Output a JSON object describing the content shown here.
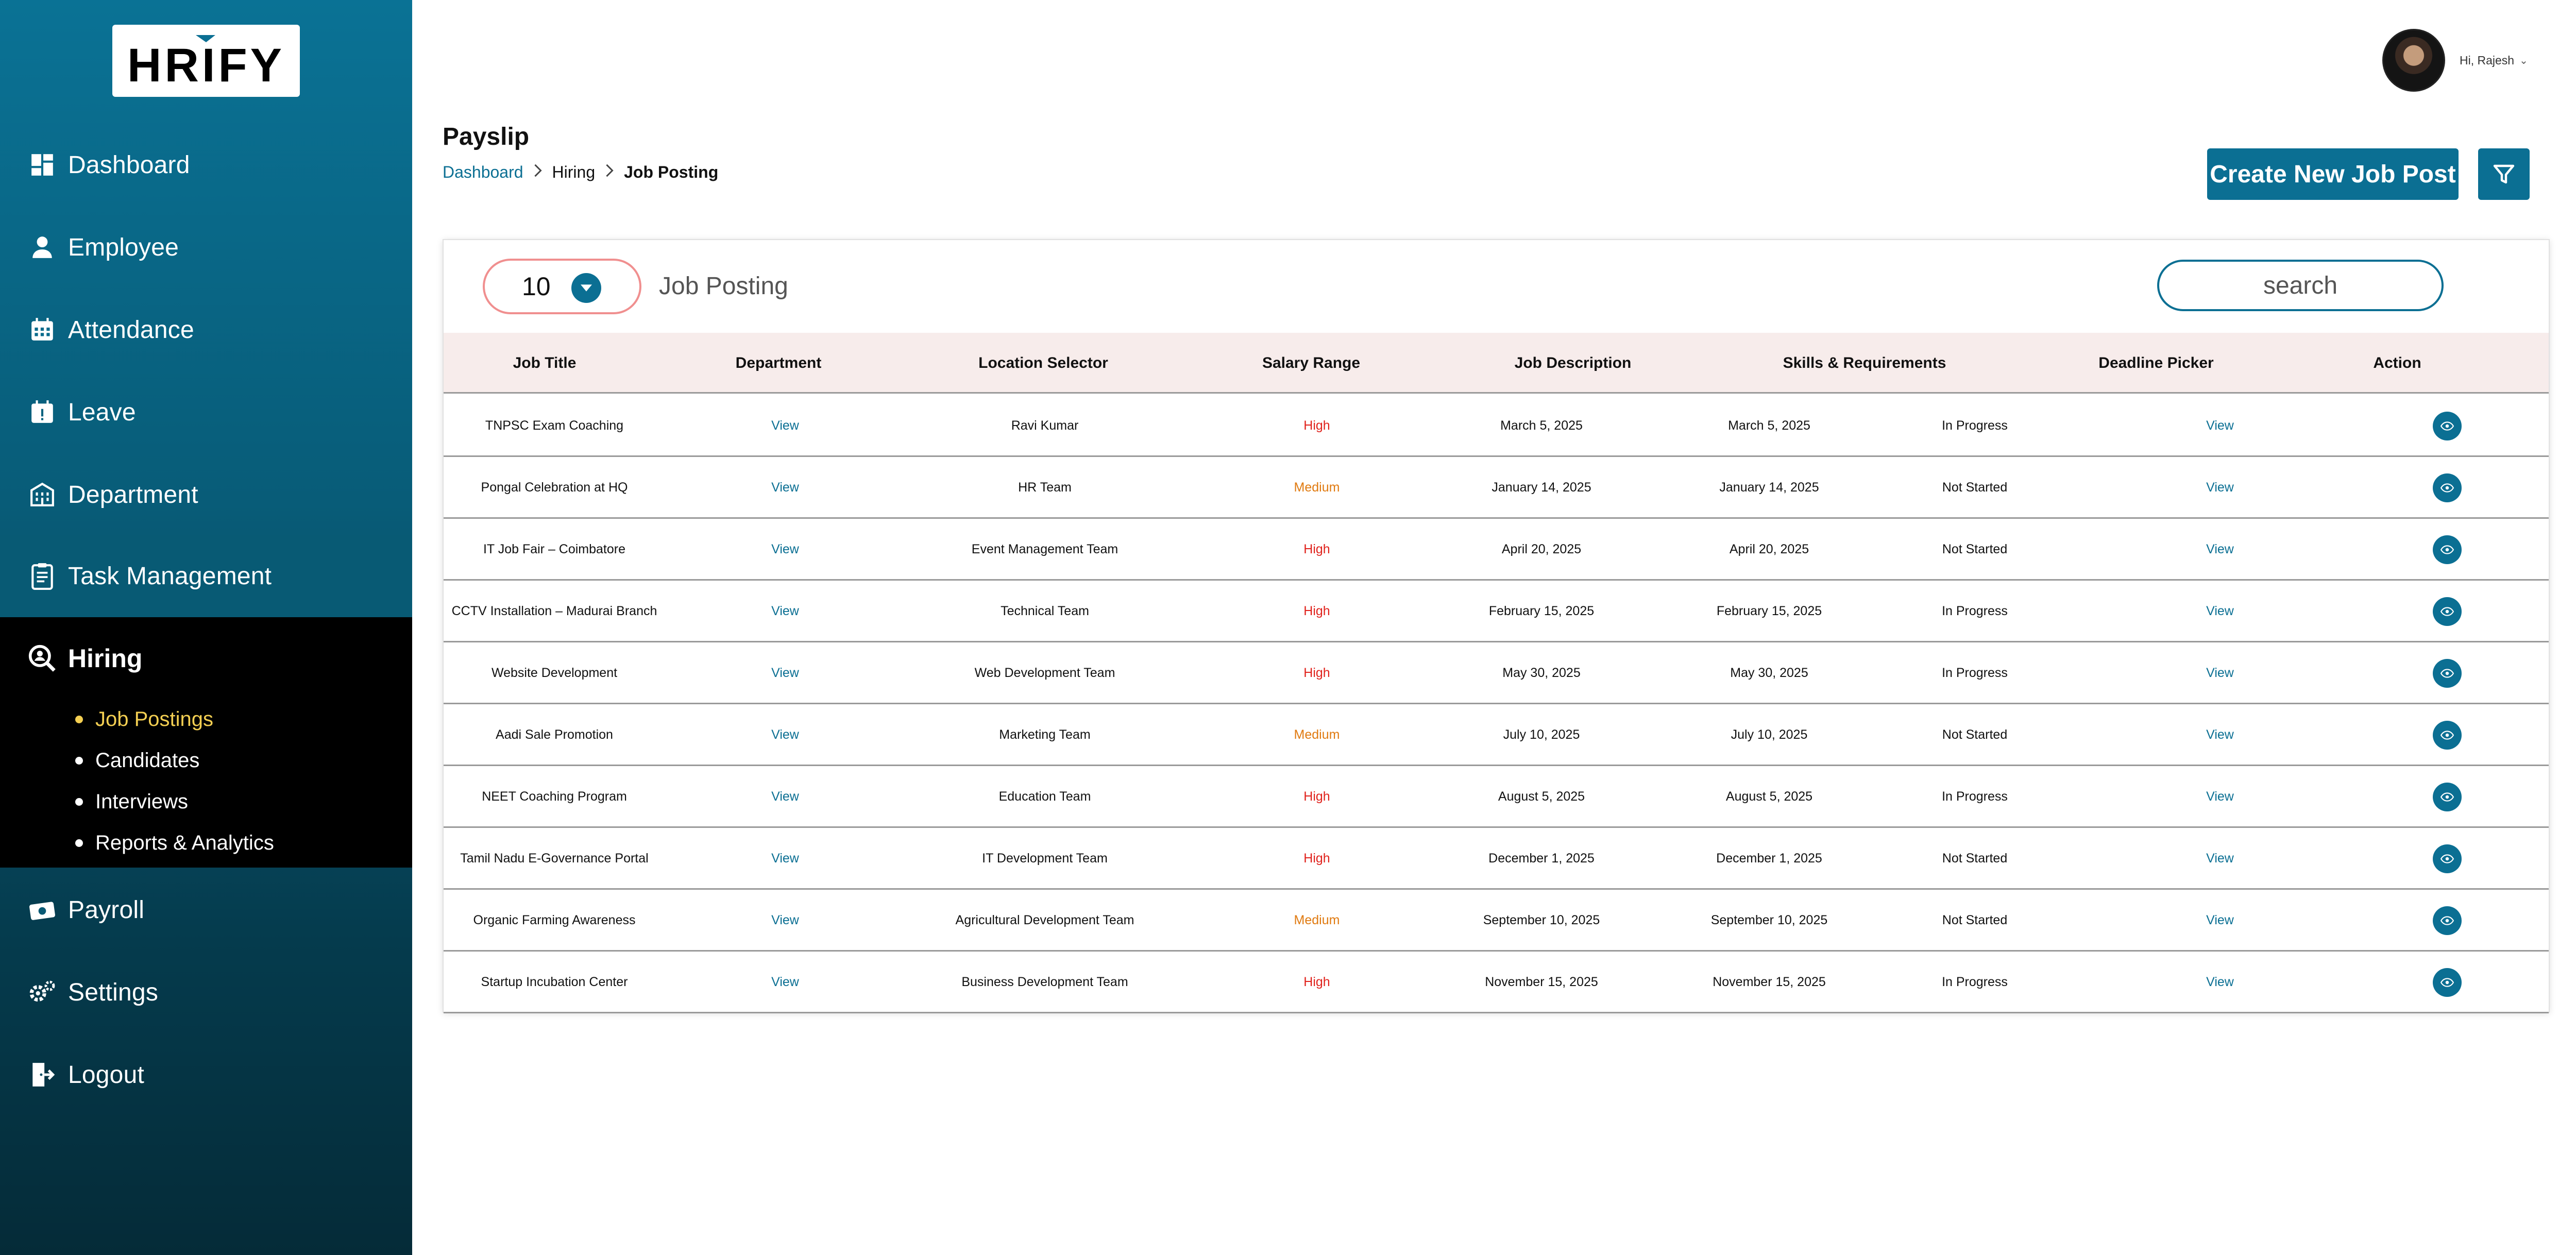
{
  "brand": {
    "logo_text": "HRIFY"
  },
  "sidebar": {
    "items": [
      {
        "label": "Dashboard",
        "icon": "dashboard-icon"
      },
      {
        "label": "Employee",
        "icon": "user-icon"
      },
      {
        "label": "Attendance",
        "icon": "calendar-icon"
      },
      {
        "label": "Leave",
        "icon": "calendar-alert-icon"
      },
      {
        "label": "Department",
        "icon": "building-icon"
      },
      {
        "label": "Task Management",
        "icon": "clipboard-icon"
      },
      {
        "label": "Hiring",
        "icon": "hiring-search-icon"
      },
      {
        "label": "Payroll",
        "icon": "money-icon"
      },
      {
        "label": "Settings",
        "icon": "gears-icon"
      },
      {
        "label": "Logout",
        "icon": "logout-icon"
      }
    ],
    "hiring_sub": [
      {
        "label": "Job Postings",
        "active": true
      },
      {
        "label": "Candidates",
        "active": false
      },
      {
        "label": "Interviews",
        "active": false
      },
      {
        "label": "Reports & Analytics",
        "active": false
      }
    ]
  },
  "header": {
    "greeting": "Hi, Rajesh",
    "chevron": "⌄",
    "title": "Payslip",
    "breadcrumb": [
      "Dashboard",
      "Hiring",
      "Job Posting"
    ],
    "create_button": "Create New Job Post",
    "filter_icon": "filter-icon"
  },
  "card": {
    "per_page": "10",
    "label": "Job Posting",
    "search_placeholder": "search"
  },
  "table": {
    "columns": [
      "Job Title",
      "Department",
      "Location Selector",
      "Salary Range",
      "Job Description",
      "Skills & Requirements",
      "Deadline Picker",
      "Action"
    ],
    "rows": [
      [
        "TNPSC Exam Coaching",
        "View",
        "Ravi Kumar",
        "High",
        "March 5, 2025",
        "March 5, 2025",
        "In Progress",
        "View"
      ],
      [
        "Pongal Celebration at HQ",
        "View",
        "HR Team",
        "Medium",
        "January 14, 2025",
        "January 14, 2025",
        "Not Started",
        "View"
      ],
      [
        "IT Job Fair – Coimbatore",
        "View",
        "Event Management Team",
        "High",
        "April 20, 2025",
        "April 20, 2025",
        "Not Started",
        "View"
      ],
      [
        "CCTV Installation – Madurai Branch",
        "View",
        "Technical Team",
        "High",
        "February 15, 2025",
        "February 15, 2025",
        "In Progress",
        "View"
      ],
      [
        "Website Development",
        "View",
        "Web Development Team",
        "High",
        "May 30, 2025",
        "May 30, 2025",
        "In Progress",
        "View"
      ],
      [
        "Aadi Sale Promotion",
        "View",
        "Marketing Team",
        "Medium",
        "July 10, 2025",
        "July 10, 2025",
        "Not Started",
        "View"
      ],
      [
        "NEET Coaching Program",
        "View",
        "Education Team",
        "High",
        "August 5, 2025",
        "August 5, 2025",
        "In Progress",
        "View"
      ],
      [
        "Tamil Nadu E-Governance Portal",
        "View",
        "IT Development Team",
        "High",
        "December 1, 2025",
        "December 1, 2025",
        "Not Started",
        "View"
      ],
      [
        "Organic Farming Awareness",
        "View",
        "Agricultural Development Team",
        "Medium",
        "September 10, 2025",
        "September 10, 2025",
        "Not Started",
        "View"
      ],
      [
        "Startup Incubation Center",
        "View",
        "Business Development Team",
        "High",
        "November 15, 2025",
        "November 15, 2025",
        "In Progress",
        "View"
      ]
    ]
  },
  "colors": {
    "accent": "#0b6f93",
    "high": "#e0211b",
    "medium": "#e07a10",
    "active_sub": "#f4cf52",
    "header_row": "#f7eceb",
    "pill_border": "#f08f8f"
  }
}
